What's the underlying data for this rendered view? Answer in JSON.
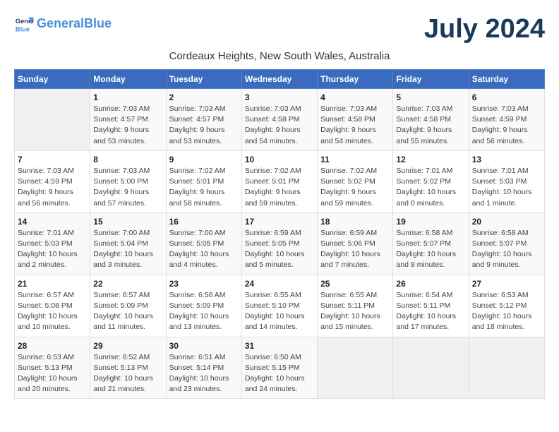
{
  "header": {
    "logo_line1": "General",
    "logo_line2": "Blue",
    "month": "July 2024",
    "location": "Cordeaux Heights, New South Wales, Australia"
  },
  "days_of_week": [
    "Sunday",
    "Monday",
    "Tuesday",
    "Wednesday",
    "Thursday",
    "Friday",
    "Saturday"
  ],
  "weeks": [
    [
      {
        "day": "",
        "info": ""
      },
      {
        "day": "1",
        "info": "Sunrise: 7:03 AM\nSunset: 4:57 PM\nDaylight: 9 hours\nand 53 minutes."
      },
      {
        "day": "2",
        "info": "Sunrise: 7:03 AM\nSunset: 4:57 PM\nDaylight: 9 hours\nand 53 minutes."
      },
      {
        "day": "3",
        "info": "Sunrise: 7:03 AM\nSunset: 4:58 PM\nDaylight: 9 hours\nand 54 minutes."
      },
      {
        "day": "4",
        "info": "Sunrise: 7:03 AM\nSunset: 4:58 PM\nDaylight: 9 hours\nand 54 minutes."
      },
      {
        "day": "5",
        "info": "Sunrise: 7:03 AM\nSunset: 4:58 PM\nDaylight: 9 hours\nand 55 minutes."
      },
      {
        "day": "6",
        "info": "Sunrise: 7:03 AM\nSunset: 4:59 PM\nDaylight: 9 hours\nand 56 minutes."
      }
    ],
    [
      {
        "day": "7",
        "info": "Sunrise: 7:03 AM\nSunset: 4:59 PM\nDaylight: 9 hours\nand 56 minutes."
      },
      {
        "day": "8",
        "info": "Sunrise: 7:03 AM\nSunset: 5:00 PM\nDaylight: 9 hours\nand 57 minutes."
      },
      {
        "day": "9",
        "info": "Sunrise: 7:02 AM\nSunset: 5:01 PM\nDaylight: 9 hours\nand 58 minutes."
      },
      {
        "day": "10",
        "info": "Sunrise: 7:02 AM\nSunset: 5:01 PM\nDaylight: 9 hours\nand 59 minutes."
      },
      {
        "day": "11",
        "info": "Sunrise: 7:02 AM\nSunset: 5:02 PM\nDaylight: 9 hours\nand 59 minutes."
      },
      {
        "day": "12",
        "info": "Sunrise: 7:01 AM\nSunset: 5:02 PM\nDaylight: 10 hours\nand 0 minutes."
      },
      {
        "day": "13",
        "info": "Sunrise: 7:01 AM\nSunset: 5:03 PM\nDaylight: 10 hours\nand 1 minute."
      }
    ],
    [
      {
        "day": "14",
        "info": "Sunrise: 7:01 AM\nSunset: 5:03 PM\nDaylight: 10 hours\nand 2 minutes."
      },
      {
        "day": "15",
        "info": "Sunrise: 7:00 AM\nSunset: 5:04 PM\nDaylight: 10 hours\nand 3 minutes."
      },
      {
        "day": "16",
        "info": "Sunrise: 7:00 AM\nSunset: 5:05 PM\nDaylight: 10 hours\nand 4 minutes."
      },
      {
        "day": "17",
        "info": "Sunrise: 6:59 AM\nSunset: 5:05 PM\nDaylight: 10 hours\nand 5 minutes."
      },
      {
        "day": "18",
        "info": "Sunrise: 6:59 AM\nSunset: 5:06 PM\nDaylight: 10 hours\nand 7 minutes."
      },
      {
        "day": "19",
        "info": "Sunrise: 6:58 AM\nSunset: 5:07 PM\nDaylight: 10 hours\nand 8 minutes."
      },
      {
        "day": "20",
        "info": "Sunrise: 6:58 AM\nSunset: 5:07 PM\nDaylight: 10 hours\nand 9 minutes."
      }
    ],
    [
      {
        "day": "21",
        "info": "Sunrise: 6:57 AM\nSunset: 5:08 PM\nDaylight: 10 hours\nand 10 minutes."
      },
      {
        "day": "22",
        "info": "Sunrise: 6:57 AM\nSunset: 5:09 PM\nDaylight: 10 hours\nand 11 minutes."
      },
      {
        "day": "23",
        "info": "Sunrise: 6:56 AM\nSunset: 5:09 PM\nDaylight: 10 hours\nand 13 minutes."
      },
      {
        "day": "24",
        "info": "Sunrise: 6:55 AM\nSunset: 5:10 PM\nDaylight: 10 hours\nand 14 minutes."
      },
      {
        "day": "25",
        "info": "Sunrise: 6:55 AM\nSunset: 5:11 PM\nDaylight: 10 hours\nand 15 minutes."
      },
      {
        "day": "26",
        "info": "Sunrise: 6:54 AM\nSunset: 5:11 PM\nDaylight: 10 hours\nand 17 minutes."
      },
      {
        "day": "27",
        "info": "Sunrise: 6:53 AM\nSunset: 5:12 PM\nDaylight: 10 hours\nand 18 minutes."
      }
    ],
    [
      {
        "day": "28",
        "info": "Sunrise: 6:53 AM\nSunset: 5:13 PM\nDaylight: 10 hours\nand 20 minutes."
      },
      {
        "day": "29",
        "info": "Sunrise: 6:52 AM\nSunset: 5:13 PM\nDaylight: 10 hours\nand 21 minutes."
      },
      {
        "day": "30",
        "info": "Sunrise: 6:51 AM\nSunset: 5:14 PM\nDaylight: 10 hours\nand 23 minutes."
      },
      {
        "day": "31",
        "info": "Sunrise: 6:50 AM\nSunset: 5:15 PM\nDaylight: 10 hours\nand 24 minutes."
      },
      {
        "day": "",
        "info": ""
      },
      {
        "day": "",
        "info": ""
      },
      {
        "day": "",
        "info": ""
      }
    ]
  ]
}
